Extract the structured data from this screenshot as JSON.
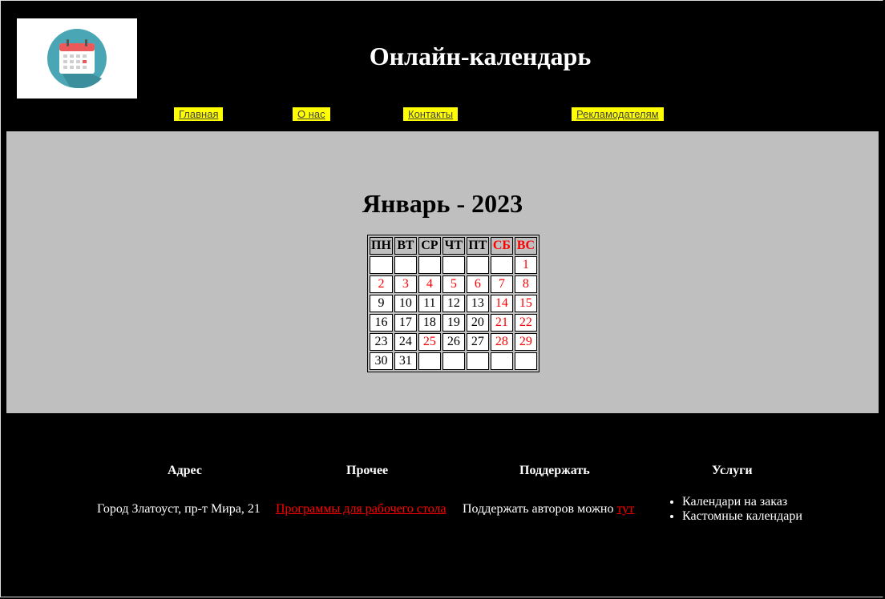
{
  "header": {
    "logo_icon": "calendar-icon",
    "title": "Онлайн-календарь"
  },
  "nav": {
    "items": [
      {
        "label": "Главная"
      },
      {
        "label": "О нас"
      },
      {
        "label": "Контакты"
      },
      {
        "label": "Рекламодателям"
      }
    ]
  },
  "calendar": {
    "title": "Январь - 2023",
    "weekdays": [
      "ПН",
      "ВТ",
      "СР",
      "ЧТ",
      "ПТ",
      "СБ",
      "ВС"
    ],
    "weekend_days": [
      "СБ",
      "ВС"
    ],
    "weeks": [
      [
        "",
        "",
        "",
        "",
        "",
        "",
        "1"
      ],
      [
        "2",
        "3",
        "4",
        "5",
        "6",
        "7",
        "8"
      ],
      [
        "9",
        "10",
        "11",
        "12",
        "13",
        "14",
        "15"
      ],
      [
        "16",
        "17",
        "18",
        "19",
        "20",
        "21",
        "22"
      ],
      [
        "23",
        "24",
        "25",
        "26",
        "27",
        "28",
        "29"
      ],
      [
        "30",
        "31",
        "",
        "",
        "",
        "",
        ""
      ]
    ],
    "red_days": [
      "1",
      "2",
      "3",
      "4",
      "5",
      "6",
      "7",
      "8",
      "14",
      "15",
      "21",
      "22",
      "25",
      "28",
      "29"
    ]
  },
  "footer": {
    "address": {
      "heading": "Адрес",
      "text": "Город Златоуст, пр-т Мира, 21"
    },
    "other": {
      "heading": "Прочее",
      "link": "Программы для рабочего стола"
    },
    "support": {
      "heading": "Поддержать",
      "text": "Поддержать авторов можно ",
      "link": "тут"
    },
    "services": {
      "heading": "Услуги",
      "items": [
        "Календари на заказ",
        "Кастомные календари"
      ]
    }
  },
  "colors": {
    "background": "#000000",
    "panel": "#bfbfbf",
    "nav_highlight": "#ffff00",
    "accent_red": "#ff0000"
  }
}
